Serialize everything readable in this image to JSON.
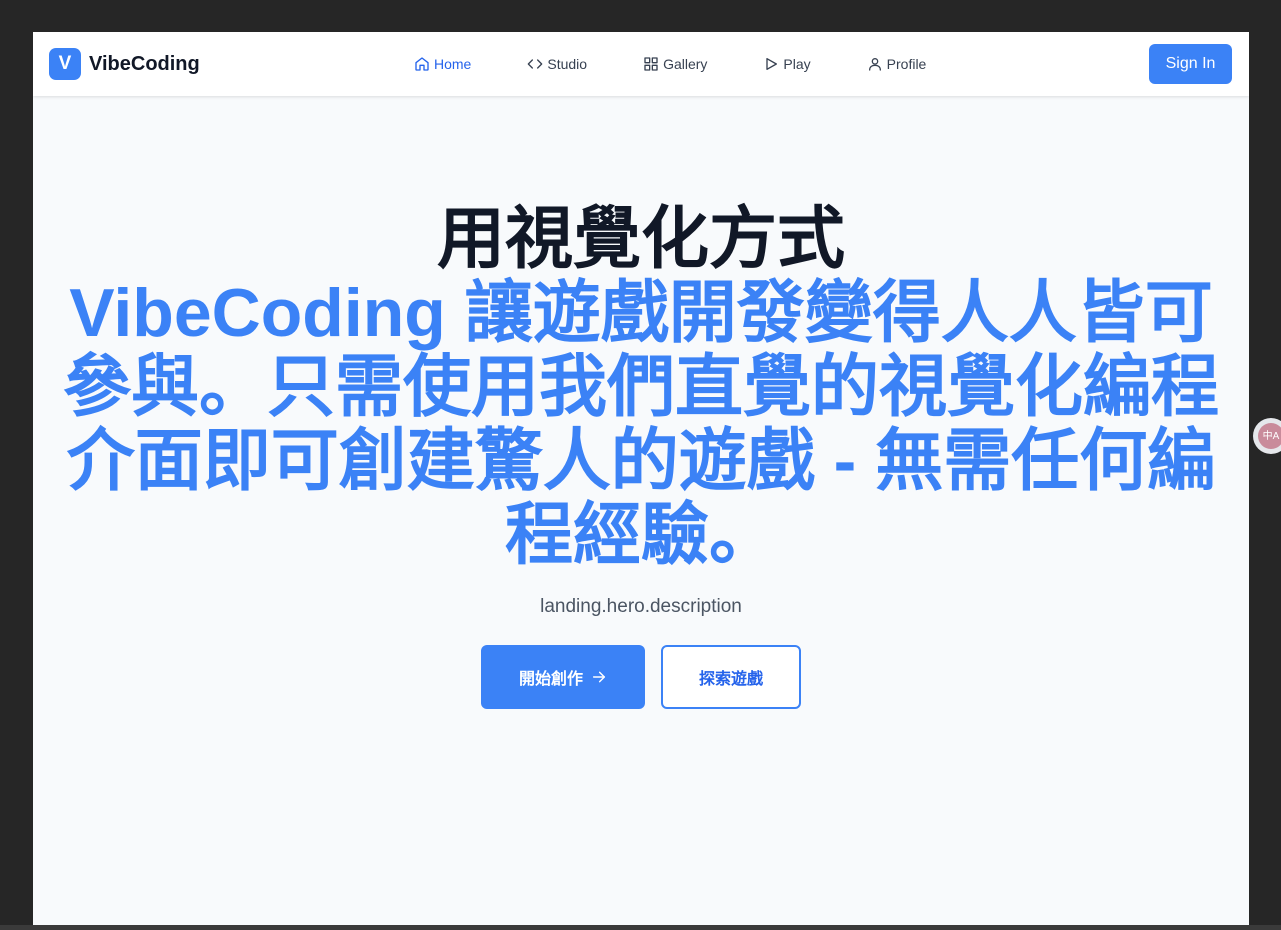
{
  "navbar": {
    "logo_letter": "V",
    "brand_name": "VibeCoding",
    "links": [
      {
        "label": "Home",
        "icon": "home-icon",
        "active": true
      },
      {
        "label": "Studio",
        "icon": "code-icon",
        "active": false
      },
      {
        "label": "Gallery",
        "icon": "grid-icon",
        "active": false
      },
      {
        "label": "Play",
        "icon": "play-icon",
        "active": false
      },
      {
        "label": "Profile",
        "icon": "user-icon",
        "active": false
      }
    ],
    "sign_in_label": "Sign In"
  },
  "hero": {
    "title_line1": "用視覺化方式",
    "title_line2": "VibeCoding 讓遊戲開發變得人人皆可參與。只需使用我們直覺的視覺化編程介面即可創建驚人的遊戲 - 無需任何編程經驗。",
    "description": "landing.hero.description",
    "primary_button": "開始創作",
    "secondary_button": "探索遊戲"
  },
  "translate_widget": {
    "icon": "translate-icon",
    "glyph": "中A"
  },
  "colors": {
    "accent": "#3b82f6",
    "heading": "#111827",
    "page_background": "#f8fafc",
    "outer_background": "#262626"
  }
}
